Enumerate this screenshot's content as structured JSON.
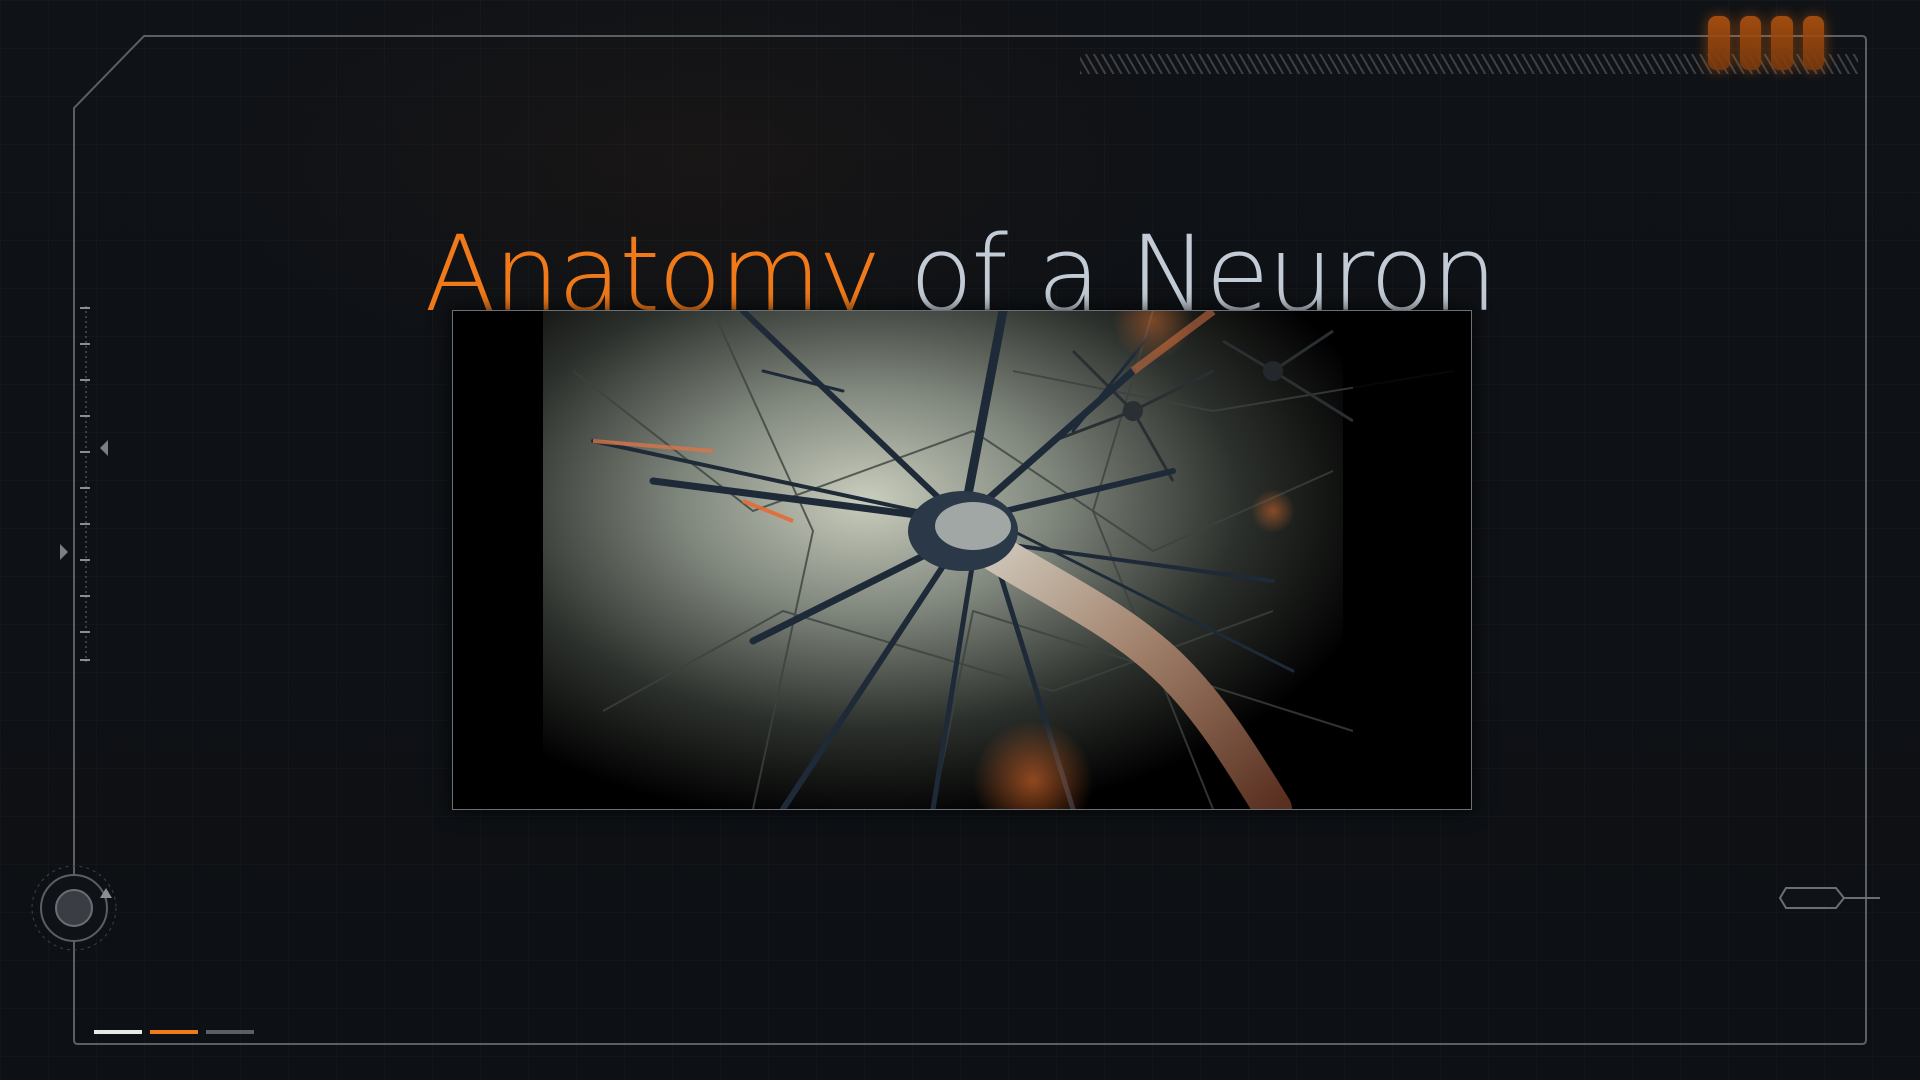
{
  "slide": {
    "title_accent": "Anatomy",
    "title_rest": "of a Neuron",
    "image_subject": "neuron-illustration"
  },
  "theme": {
    "accent": "#f07a1a",
    "title_text": "#c3ccd6",
    "background": "#0e1115",
    "frame_line": "#5a5f66"
  },
  "indicators": {
    "count": 4,
    "color": "#b2530f"
  },
  "progress_tabs": [
    {
      "color": "#e8e8e8"
    },
    {
      "color": "#f07a1a"
    },
    {
      "color": "#5a5f66"
    }
  ]
}
